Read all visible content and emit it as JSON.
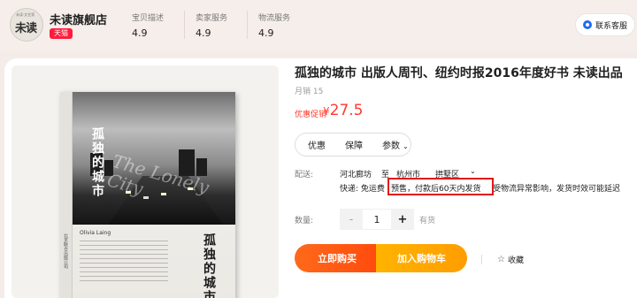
{
  "shop": {
    "logo_text": "未读",
    "logo_sub": "A-Z DR",
    "logo_top": "未读·文艺家",
    "name": "未读旗舰店",
    "badge": "天猫"
  },
  "metrics": [
    {
      "label": "宝贝描述",
      "value": "4.9"
    },
    {
      "label": "卖家服务",
      "value": "4.9"
    },
    {
      "label": "物流服务",
      "value": "4.9"
    }
  ],
  "service_label": "联系客服",
  "book_cover": {
    "title_vertical": "孤独的城市",
    "title_vertical_2": "孤独的城市",
    "english_title": "The Lonely City",
    "author": "Olivia Laing",
    "spine_text": "北京联合出版公司"
  },
  "product": {
    "title": "孤独的城市 出版人周刊、纽约时报2016年度好书 未读出品",
    "sales": "月销 15",
    "price_label": "优惠促销",
    "currency": "¥",
    "price": "27.5"
  },
  "tabs": [
    {
      "label": "优惠"
    },
    {
      "label": "保障"
    },
    {
      "label": "参数",
      "chevron": "⌄"
    }
  ],
  "shipping": {
    "label": "配送:",
    "from": "河北廊坊",
    "to_word": "至",
    "city": "杭州市",
    "district": "拱墅区",
    "express": "快递: 免运费",
    "presale": "预售，付款后60天内发货",
    "note": "受物流异常影响，发货时效可能延迟"
  },
  "quantity": {
    "label": "数量:",
    "minus": "-",
    "value": "1",
    "plus": "+",
    "stock": "有货"
  },
  "actions": {
    "buy_now": "立即购买",
    "add_cart": "加入购物车",
    "favorite": "收藏"
  },
  "colors": {
    "accent": "#ff3a2e",
    "buy_button": "#ff5a14",
    "cart_button": "#ffa500",
    "tmall_red": "#ff1c3d",
    "highlight_box": "#e11818"
  }
}
